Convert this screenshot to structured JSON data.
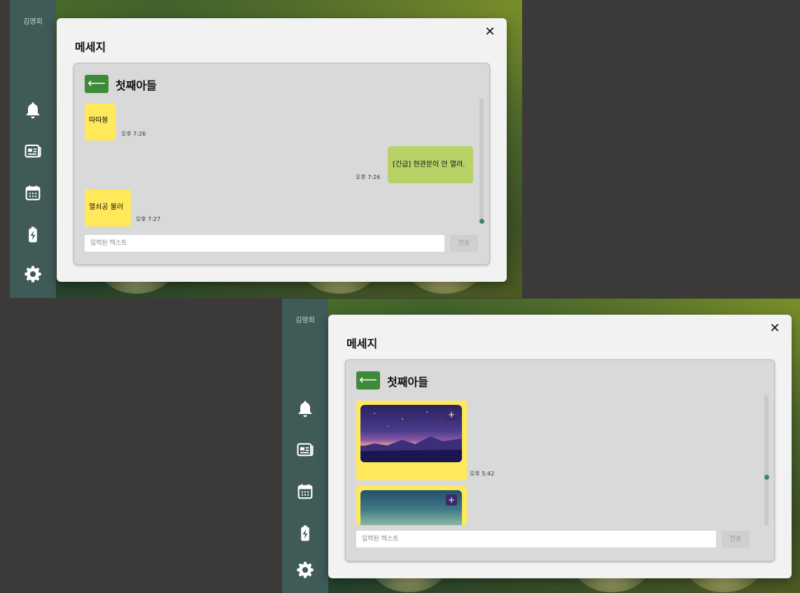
{
  "sidebar": {
    "user_name": "김영희"
  },
  "modal": {
    "title": "메세지",
    "close_symbol": "✕"
  },
  "chat": {
    "back_symbol": "⟵",
    "contact_name": "첫째아들",
    "input_placeholder": "입력된 텍스트",
    "send_label": "전송"
  },
  "view1": {
    "messages": [
      {
        "direction": "received",
        "text": "따따봉",
        "time": "오후 7:26"
      },
      {
        "direction": "sent",
        "text": "[긴급] 현관문이 안 열려.",
        "time": "오후 7:26"
      },
      {
        "direction": "received",
        "text": "열쇠공 불러",
        "time": "오후 7:27"
      }
    ]
  },
  "view2": {
    "messages": [
      {
        "direction": "received",
        "type": "image",
        "image": "night-sky-mountain-photo",
        "time": "오후 5:42"
      },
      {
        "direction": "received",
        "type": "image",
        "image": "teal-sky-photo"
      }
    ],
    "image_button_symbol": "+"
  },
  "colors": {
    "sidebar": "#3f5a57",
    "received_bubble": "#ffe95a",
    "sent_bubble": "#b8d268",
    "back_button": "#3e8a3a"
  },
  "icons": [
    "bell-icon",
    "news-icon",
    "calendar-icon",
    "battery-icon",
    "gear-icon"
  ]
}
